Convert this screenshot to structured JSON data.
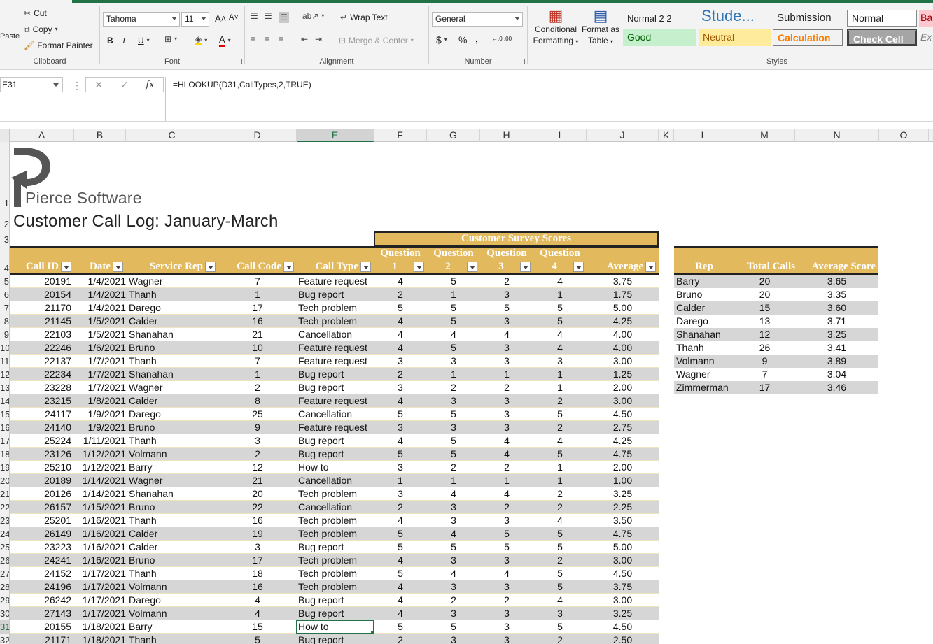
{
  "ribbon": {
    "clipboard": {
      "cut": "Cut",
      "copy": "Copy",
      "format_painter": "Format Painter",
      "paste": "Paste",
      "label": "Clipboard"
    },
    "font": {
      "name": "Tahoma",
      "size": "11",
      "label": "Font",
      "bold": "B",
      "italic": "I",
      "underline": "U",
      "grow": "A˄",
      "shrink": "A˅",
      "font_color_letter": "A"
    },
    "alignment": {
      "wrap_text": "Wrap Text",
      "merge_center": "Merge & Center",
      "label": "Alignment"
    },
    "number": {
      "format": "General",
      "currency": "$",
      "percent": "%",
      "comma": ",",
      "inc_decimal": "←.0 .00",
      "dec_decimal": ".00 →.0",
      "label": "Number"
    },
    "conditional": {
      "line1": "Conditional",
      "line2": "Formatting"
    },
    "format_table": {
      "line1": "Format as",
      "line2": "Table"
    },
    "styles": {
      "label": "Styles",
      "items": [
        {
          "text": "Normal 2 2"
        },
        {
          "text": "Stude..."
        },
        {
          "text": "Submission"
        },
        {
          "text": "Normal"
        },
        {
          "text": "Ba"
        },
        {
          "text": "Good"
        },
        {
          "text": "Neutral"
        },
        {
          "text": "Calculation"
        },
        {
          "text": "Check Cell"
        },
        {
          "text": "Ex"
        }
      ]
    }
  },
  "formula_bar": {
    "name_box": "E31",
    "formula": "=HLOOKUP(D31,CallTypes,2,TRUE)",
    "cancel": "✕",
    "enter": "✓",
    "fx": "fx"
  },
  "columns": [
    "A",
    "B",
    "C",
    "D",
    "E",
    "F",
    "G",
    "H",
    "I",
    "J",
    "K",
    "L",
    "M",
    "N",
    "O"
  ],
  "row_numbers": [
    "1",
    "2",
    "3",
    "4",
    "5",
    "6",
    "7",
    "8",
    "9",
    "10",
    "11",
    "12",
    "13",
    "14",
    "15",
    "16",
    "17",
    "18",
    "19",
    "20",
    "21",
    "22",
    "23",
    "24",
    "25",
    "26",
    "27",
    "28",
    "29",
    "30",
    "31",
    "32"
  ],
  "sheet": {
    "logo_text": "Pierce Software",
    "title": "Customer Call Log: January-March",
    "survey_banner": "Customer Survey Scores",
    "headers": {
      "call_id": "Call ID",
      "date": "Date",
      "service_rep": "Service Rep",
      "call_code": "Call Code",
      "call_type": "Call Type",
      "q_top": "Question",
      "q1": "1",
      "q2": "2",
      "q3": "3",
      "q4": "4",
      "average": "Average"
    },
    "rows": [
      {
        "id": "20191",
        "date": "1/4/2021",
        "rep": "Wagner",
        "code": "7",
        "type": "Feature request",
        "q1": "4",
        "q2": "5",
        "q3": "2",
        "q4": "4",
        "avg": "3.75"
      },
      {
        "id": "20154",
        "date": "1/4/2021",
        "rep": "Thanh",
        "code": "1",
        "type": "Bug report",
        "q1": "2",
        "q2": "1",
        "q3": "3",
        "q4": "1",
        "avg": "1.75"
      },
      {
        "id": "21170",
        "date": "1/4/2021",
        "rep": "Darego",
        "code": "17",
        "type": "Tech problem",
        "q1": "5",
        "q2": "5",
        "q3": "5",
        "q4": "5",
        "avg": "5.00"
      },
      {
        "id": "21145",
        "date": "1/5/2021",
        "rep": "Calder",
        "code": "16",
        "type": "Tech problem",
        "q1": "4",
        "q2": "5",
        "q3": "3",
        "q4": "5",
        "avg": "4.25"
      },
      {
        "id": "22103",
        "date": "1/5/2021",
        "rep": "Shanahan",
        "code": "21",
        "type": "Cancellation",
        "q1": "4",
        "q2": "4",
        "q3": "4",
        "q4": "4",
        "avg": "4.00"
      },
      {
        "id": "22246",
        "date": "1/6/2021",
        "rep": "Bruno",
        "code": "10",
        "type": "Feature request",
        "q1": "4",
        "q2": "5",
        "q3": "3",
        "q4": "4",
        "avg": "4.00"
      },
      {
        "id": "22137",
        "date": "1/7/2021",
        "rep": "Thanh",
        "code": "7",
        "type": "Feature request",
        "q1": "3",
        "q2": "3",
        "q3": "3",
        "q4": "3",
        "avg": "3.00"
      },
      {
        "id": "22234",
        "date": "1/7/2021",
        "rep": "Shanahan",
        "code": "1",
        "type": "Bug report",
        "q1": "2",
        "q2": "1",
        "q3": "1",
        "q4": "1",
        "avg": "1.25"
      },
      {
        "id": "23228",
        "date": "1/7/2021",
        "rep": "Wagner",
        "code": "2",
        "type": "Bug report",
        "q1": "3",
        "q2": "2",
        "q3": "2",
        "q4": "1",
        "avg": "2.00"
      },
      {
        "id": "23215",
        "date": "1/8/2021",
        "rep": "Calder",
        "code": "8",
        "type": "Feature request",
        "q1": "4",
        "q2": "3",
        "q3": "3",
        "q4": "2",
        "avg": "3.00"
      },
      {
        "id": "24117",
        "date": "1/9/2021",
        "rep": "Darego",
        "code": "25",
        "type": "Cancellation",
        "q1": "5",
        "q2": "5",
        "q3": "3",
        "q4": "5",
        "avg": "4.50"
      },
      {
        "id": "24140",
        "date": "1/9/2021",
        "rep": "Bruno",
        "code": "9",
        "type": "Feature request",
        "q1": "3",
        "q2": "3",
        "q3": "3",
        "q4": "2",
        "avg": "2.75"
      },
      {
        "id": "25224",
        "date": "1/11/2021",
        "rep": "Thanh",
        "code": "3",
        "type": "Bug report",
        "q1": "4",
        "q2": "5",
        "q3": "4",
        "q4": "4",
        "avg": "4.25"
      },
      {
        "id": "23126",
        "date": "1/12/2021",
        "rep": "Volmann",
        "code": "2",
        "type": "Bug report",
        "q1": "5",
        "q2": "5",
        "q3": "4",
        "q4": "5",
        "avg": "4.75"
      },
      {
        "id": "25210",
        "date": "1/12/2021",
        "rep": "Barry",
        "code": "12",
        "type": "How to",
        "q1": "3",
        "q2": "2",
        "q3": "2",
        "q4": "1",
        "avg": "2.00"
      },
      {
        "id": "20189",
        "date": "1/14/2021",
        "rep": "Wagner",
        "code": "21",
        "type": "Cancellation",
        "q1": "1",
        "q2": "1",
        "q3": "1",
        "q4": "1",
        "avg": "1.00"
      },
      {
        "id": "20126",
        "date": "1/14/2021",
        "rep": "Shanahan",
        "code": "20",
        "type": "Tech problem",
        "q1": "3",
        "q2": "4",
        "q3": "4",
        "q4": "2",
        "avg": "3.25"
      },
      {
        "id": "26157",
        "date": "1/15/2021",
        "rep": "Bruno",
        "code": "22",
        "type": "Cancellation",
        "q1": "2",
        "q2": "3",
        "q3": "2",
        "q4": "2",
        "avg": "2.25"
      },
      {
        "id": "25201",
        "date": "1/16/2021",
        "rep": "Thanh",
        "code": "16",
        "type": "Tech problem",
        "q1": "4",
        "q2": "3",
        "q3": "3",
        "q4": "4",
        "avg": "3.50"
      },
      {
        "id": "26149",
        "date": "1/16/2021",
        "rep": "Calder",
        "code": "19",
        "type": "Tech problem",
        "q1": "5",
        "q2": "4",
        "q3": "5",
        "q4": "5",
        "avg": "4.75"
      },
      {
        "id": "23223",
        "date": "1/16/2021",
        "rep": "Calder",
        "code": "3",
        "type": "Bug report",
        "q1": "5",
        "q2": "5",
        "q3": "5",
        "q4": "5",
        "avg": "5.00"
      },
      {
        "id": "24241",
        "date": "1/16/2021",
        "rep": "Bruno",
        "code": "17",
        "type": "Tech problem",
        "q1": "4",
        "q2": "3",
        "q3": "3",
        "q4": "2",
        "avg": "3.00"
      },
      {
        "id": "24152",
        "date": "1/17/2021",
        "rep": "Thanh",
        "code": "18",
        "type": "Tech problem",
        "q1": "5",
        "q2": "4",
        "q3": "4",
        "q4": "5",
        "avg": "4.50"
      },
      {
        "id": "24196",
        "date": "1/17/2021",
        "rep": "Volmann",
        "code": "16",
        "type": "Tech problem",
        "q1": "4",
        "q2": "3",
        "q3": "3",
        "q4": "5",
        "avg": "3.75"
      },
      {
        "id": "26242",
        "date": "1/17/2021",
        "rep": "Darego",
        "code": "4",
        "type": "Bug report",
        "q1": "4",
        "q2": "2",
        "q3": "2",
        "q4": "4",
        "avg": "3.00"
      },
      {
        "id": "27143",
        "date": "1/17/2021",
        "rep": "Volmann",
        "code": "4",
        "type": "Bug report",
        "q1": "4",
        "q2": "3",
        "q3": "3",
        "q4": "3",
        "avg": "3.25"
      },
      {
        "id": "20155",
        "date": "1/18/2021",
        "rep": "Barry",
        "code": "15",
        "type": "How to",
        "q1": "5",
        "q2": "5",
        "q3": "3",
        "q4": "5",
        "avg": "4.50"
      },
      {
        "id": "21171",
        "date": "1/18/2021",
        "rep": "Thanh",
        "code": "5",
        "type": "Bug report",
        "q1": "2",
        "q2": "3",
        "q3": "3",
        "q4": "2",
        "avg": "2.50"
      }
    ],
    "rep_headers": {
      "rep": "Rep",
      "total": "Total Calls",
      "avg": "Average Score"
    },
    "reps": [
      {
        "rep": "Barry",
        "total": "20",
        "avg": "3.65"
      },
      {
        "rep": "Bruno",
        "total": "20",
        "avg": "3.35"
      },
      {
        "rep": "Calder",
        "total": "15",
        "avg": "3.60"
      },
      {
        "rep": "Darego",
        "total": "13",
        "avg": "3.71"
      },
      {
        "rep": "Shanahan",
        "total": "12",
        "avg": "3.25"
      },
      {
        "rep": "Thanh",
        "total": "26",
        "avg": "3.41"
      },
      {
        "rep": "Volmann",
        "total": "9",
        "avg": "3.89"
      },
      {
        "rep": "Wagner",
        "total": "7",
        "avg": "3.04"
      },
      {
        "rep": "Zimmerman",
        "total": "17",
        "avg": "3.46"
      }
    ]
  },
  "colors": {
    "accent": "#217346",
    "header_gold": "#e2b95d",
    "band_gray": "#d6d6d6"
  }
}
